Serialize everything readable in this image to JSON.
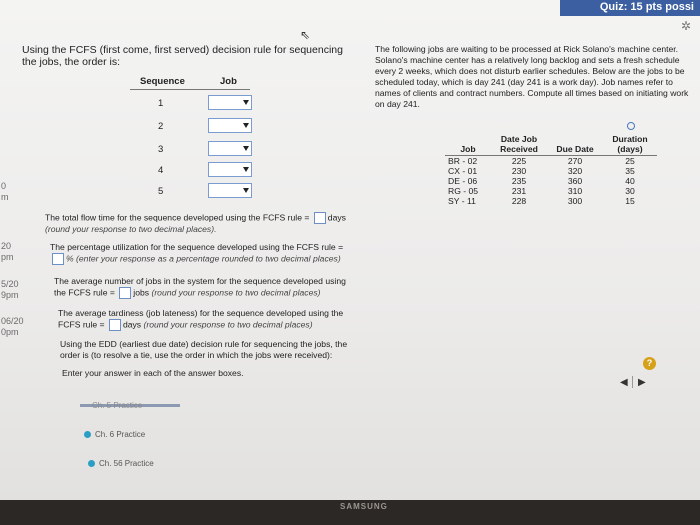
{
  "topbar": {
    "text": "Quiz: 15 pts possi"
  },
  "left_labels": [
    "0",
    "m",
    "20",
    "pm",
    "5/20",
    "9pm",
    "06/20",
    "0pm"
  ],
  "question": {
    "prompt": "Using the FCFS (first come, first served) decision rule for sequencing the jobs, the order is:",
    "headers": {
      "sequence": "Sequence",
      "job": "Job"
    },
    "sequence_numbers": [
      "1",
      "2",
      "3",
      "4",
      "5"
    ]
  },
  "questions": {
    "q1_label": "The total flow time for the sequence developed using the FCFS rule = ",
    "q1_unit": "days",
    "q1_hint": "(round your response to two decimal places).",
    "q2_label": "The percentage utilization for the sequence developed using the FCFS rule = ",
    "q2_unit": "% (enter your response as a percentage rounded to two decimal places)",
    "q3_label": "The average number of jobs in the system for the sequence developed using the FCFS rule = ",
    "q3_unit": "jobs",
    "q3_hint": "(round your response to two decimal places)",
    "q4_label": "The average tardiness (job lateness) for the sequence developed using the FCFS rule = ",
    "q4_unit": "days",
    "q4_hint": "(round your response to two decimal places)",
    "edd_text": "Using the EDD (earliest due date) decision rule for sequencing the jobs, the order is (to resolve a tie, use the order in which the jobs were received):",
    "enter_text": "Enter your answer in each of the answer boxes."
  },
  "info": {
    "text": "The following jobs are waiting to be processed at Rick Solano's machine center. Solano's machine center has a relatively long backlog and sets a fresh schedule every 2 weeks, which does not disturb earlier schedules. Below are the jobs to be scheduled today, which is day 241 (day 241 is a work day). Job names refer to names of clients and contract numbers. Compute all times based on initiating work on day 241.",
    "table_headers": {
      "job": "Job",
      "date_received": "Date Job Received",
      "due_date": "Due Date",
      "duration": "Duration (days)"
    },
    "rows": [
      {
        "job": "BR - 02",
        "received": "225",
        "due": "270",
        "duration": "25"
      },
      {
        "job": "CX - 01",
        "received": "230",
        "due": "320",
        "duration": "35"
      },
      {
        "job": "DE - 06",
        "received": "235",
        "due": "360",
        "duration": "40"
      },
      {
        "job": "RG - 05",
        "received": "231",
        "due": "310",
        "duration": "30"
      },
      {
        "job": "SY - 11",
        "received": "228",
        "due": "300",
        "duration": "15"
      }
    ]
  },
  "practice": {
    "item1": "Ch. 5 Practice",
    "item2": "Ch. 6 Practice",
    "item3": "Ch. 56 Practice"
  },
  "nav": {
    "prev": "◀",
    "next": "▶"
  },
  "help": {
    "label": "?"
  },
  "brand": "SAMSUNG"
}
